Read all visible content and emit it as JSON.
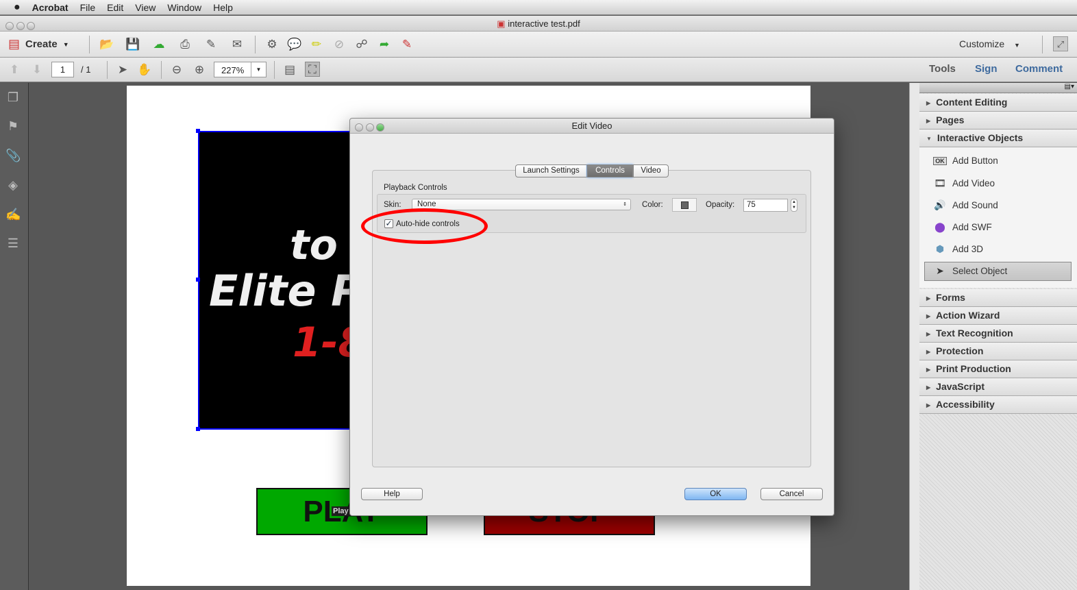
{
  "menubar": {
    "app": "Acrobat",
    "items": [
      "File",
      "Edit",
      "View",
      "Window",
      "Help"
    ]
  },
  "window": {
    "title": "interactive test.pdf"
  },
  "toolbar": {
    "create_label": "Create",
    "customize_label": "Customize",
    "page_current": "1",
    "page_total": "/ 1",
    "zoom": "227%"
  },
  "tabs": {
    "tools": "Tools",
    "sign": "Sign",
    "comment": "Comment"
  },
  "document": {
    "video_lines": [
      "to S",
      "Elite Pr",
      "1-8"
    ],
    "play_label": "PLAY",
    "stop_label": "STOP",
    "tooltip": "Play",
    "colors": {
      "play": "#00a800",
      "stop": "#a00000",
      "selection": "#0000ff"
    }
  },
  "right_panel": {
    "sections_top": [
      "Content Editing",
      "Pages",
      "Interactive Objects"
    ],
    "interactive_items": [
      "Add Button",
      "Add Video",
      "Add Sound",
      "Add SWF",
      "Add 3D",
      "Select Object"
    ],
    "sections_bottom": [
      "Forms",
      "Action Wizard",
      "Text Recognition",
      "Protection",
      "Print Production",
      "JavaScript",
      "Accessibility"
    ]
  },
  "dialog": {
    "title": "Edit Video",
    "tabs": [
      "Launch Settings",
      "Controls",
      "Video"
    ],
    "active_tab": "Controls",
    "group_label": "Playback Controls",
    "skin_label": "Skin:",
    "skin_value": "None",
    "color_label": "Color:",
    "color_value": "#666666",
    "opacity_label": "Opacity:",
    "opacity_value": "75",
    "autohide_label": "Auto-hide controls",
    "autohide_checked": true,
    "help": "Help",
    "ok": "OK",
    "cancel": "Cancel",
    "annotation_color": "#ff0000"
  }
}
